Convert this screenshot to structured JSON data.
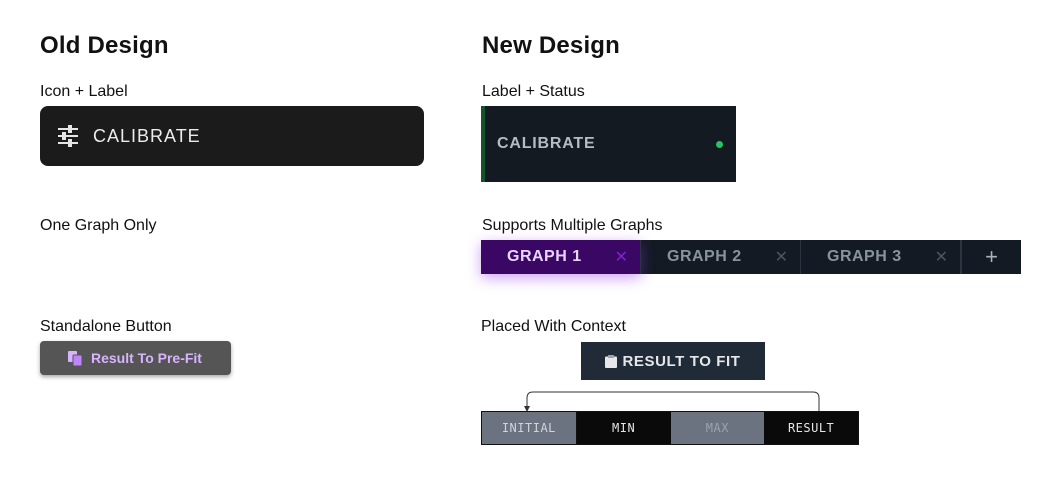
{
  "old": {
    "title": "Old Design",
    "calibrate_caption": "Icon + Label",
    "calibrate_label": "CALIBRATE",
    "graph_caption": "One Graph Only",
    "button_caption": "Standalone Button",
    "button_label": "Result To Pre-Fit"
  },
  "new": {
    "title": "New Design",
    "calibrate_caption": "Label + Status",
    "calibrate_label": "CALIBRATE",
    "status_color": "#22c55e",
    "graph_caption": "Supports Multiple Graphs",
    "tabs": [
      {
        "label": "GRAPH 1",
        "close": "✕",
        "active": true
      },
      {
        "label": "GRAPH 2",
        "close": "✕",
        "active": false
      },
      {
        "label": "GRAPH 3",
        "close": "✕",
        "active": false
      }
    ],
    "add_tab": "+",
    "button_caption": "Placed With Context",
    "button_label": "RESULT TO FIT",
    "segments": [
      "INITIAL",
      "MIN",
      "MAX",
      "RESULT"
    ]
  },
  "icons": {
    "calibrate": "sliders-icon",
    "old_button": "copy-icon",
    "new_button": "clipboard-icon"
  }
}
